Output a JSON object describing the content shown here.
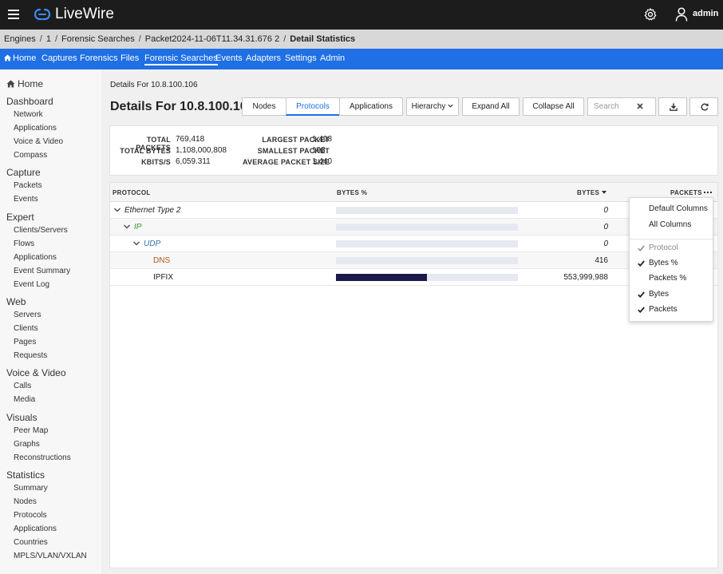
{
  "app": {
    "title": "LiveWire",
    "user": "admin"
  },
  "breadcrumb": [
    "Engines",
    "1",
    "Forensic Searches",
    "Packet2024-11-06T11.34.31.676 2",
    "Detail Statistics"
  ],
  "nav": [
    "Home",
    "Captures",
    "Forensics",
    "Files",
    "Forensic Searches",
    "Events",
    "Adapters",
    "Settings",
    "Admin"
  ],
  "nav_active": "Forensic Searches",
  "sidebar": {
    "home": "Home",
    "sections": [
      {
        "title": "Dashboard",
        "items": [
          "Network",
          "Applications",
          "Voice & Video",
          "Compass"
        ]
      },
      {
        "title": "Capture",
        "items": [
          "Packets",
          "Events"
        ]
      },
      {
        "title": "Expert",
        "items": [
          "Clients/Servers",
          "Flows",
          "Applications",
          "Event Summary",
          "Event Log"
        ]
      },
      {
        "title": "Web",
        "items": [
          "Servers",
          "Clients",
          "Pages",
          "Requests"
        ]
      },
      {
        "title": "Voice & Video",
        "items": [
          "Calls",
          "Media"
        ]
      },
      {
        "title": "Visuals",
        "items": [
          "Peer Map",
          "Graphs",
          "Reconstructions"
        ]
      },
      {
        "title": "Statistics",
        "items": [
          "Summary",
          "Nodes",
          "Protocols",
          "Applications",
          "Countries",
          "MPLS/VLAN/VXLAN"
        ]
      }
    ]
  },
  "page": {
    "subtitle": "Details For 10.8.100.106",
    "title": "Details For 10.8.100.106"
  },
  "toolbar": {
    "tabs": [
      "Nodes",
      "Protocols",
      "Applications"
    ],
    "active_tab": "Protocols",
    "hierarchy": "Hierarchy",
    "expand_all": "Expand All",
    "collapse_all": "Collapse All",
    "search_placeholder": "Search"
  },
  "summary": {
    "total_packets_label": "TOTAL PACKETS",
    "total_packets": "769,418",
    "total_bytes_label": "TOTAL BYTES",
    "total_bytes": "1,108,000,808",
    "kbits_label": "KBITS/S",
    "kbits": "6,059.311",
    "largest_label": "LARGEST PACKET",
    "largest": "1,498",
    "smallest_label": "SMALLEST PACKET",
    "smallest": "198",
    "average_label": "AVERAGE PACKET SIZE",
    "average": "1,440"
  },
  "table": {
    "headers": {
      "protocol": "PROTOCOL",
      "bytes_pct": "BYTES %",
      "bytes": "BYTES",
      "packets": "PACKETS"
    },
    "rows": [
      {
        "name": "Ethernet Type 2",
        "bytes": "0",
        "bytes_pct": 0,
        "color": "#222222",
        "italic": true
      },
      {
        "name": "IP",
        "bytes": "0",
        "bytes_pct": 0,
        "color": "#2e9a2e",
        "italic": true
      },
      {
        "name": "UDP",
        "bytes": "0",
        "bytes_pct": 0,
        "color": "#3470b0",
        "italic": true
      },
      {
        "name": "DNS",
        "bytes": "416",
        "bytes_pct": 0,
        "color": "#b5541c",
        "italic": false
      },
      {
        "name": "IPFIX",
        "bytes": "553,999,988",
        "bytes_pct": 50,
        "color": "#222222",
        "italic": false
      }
    ]
  },
  "column_menu": {
    "default_columns": "Default Columns",
    "all_columns": "All Columns",
    "columns": [
      {
        "label": "Protocol",
        "checked": true,
        "disabled": true
      },
      {
        "label": "Bytes %",
        "checked": true,
        "disabled": false
      },
      {
        "label": "Packets %",
        "checked": false,
        "disabled": false
      },
      {
        "label": "Bytes",
        "checked": true,
        "disabled": false
      },
      {
        "label": "Packets",
        "checked": true,
        "disabled": false
      }
    ]
  },
  "colors": {
    "accent": "#1f6fe5",
    "topbar": "#1c1c1c",
    "bar_fill": "#1c1a4a"
  }
}
